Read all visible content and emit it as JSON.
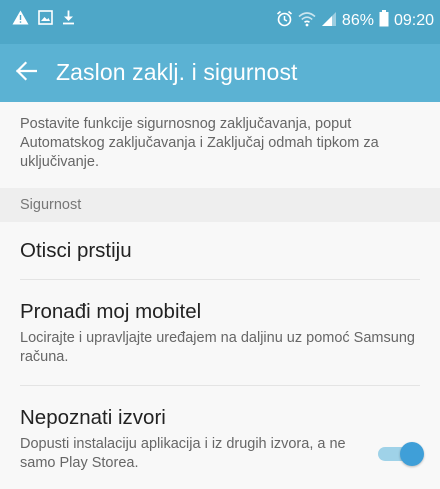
{
  "colors": {
    "status_bar": "#4ea7c8",
    "app_bar": "#5bb2d3",
    "toggle_on": "#3f9fd8"
  },
  "status_bar": {
    "left_icons": [
      "warning-icon",
      "image-icon",
      "download-icon"
    ],
    "right_icons": [
      "alarm-icon",
      "wifi-icon",
      "signal-icon",
      "battery-icon"
    ],
    "battery": "86%",
    "time": "09:20"
  },
  "app_bar": {
    "back_icon": "arrow-left-icon",
    "title": "Zaslon zaklj. i sigurnost"
  },
  "description": "Postavite funkcije sigurnosnog zaključavanja, poput Automatskog zaključavanja i Zaključaj odmah tipkom za uključivanje.",
  "section": {
    "header": "Sigurnost"
  },
  "items": [
    {
      "title": "Otisci prstiju"
    },
    {
      "title": "Pronađi moj mobitel",
      "subtitle": "Locirajte i upravljajte uređajem na daljinu uz pomoć Samsung računa."
    },
    {
      "title": "Nepoznati izvori",
      "subtitle": "Dopusti instalaciju aplikacija i iz drugih izvora, a ne samo Play Storea.",
      "toggle_on": true
    }
  ]
}
